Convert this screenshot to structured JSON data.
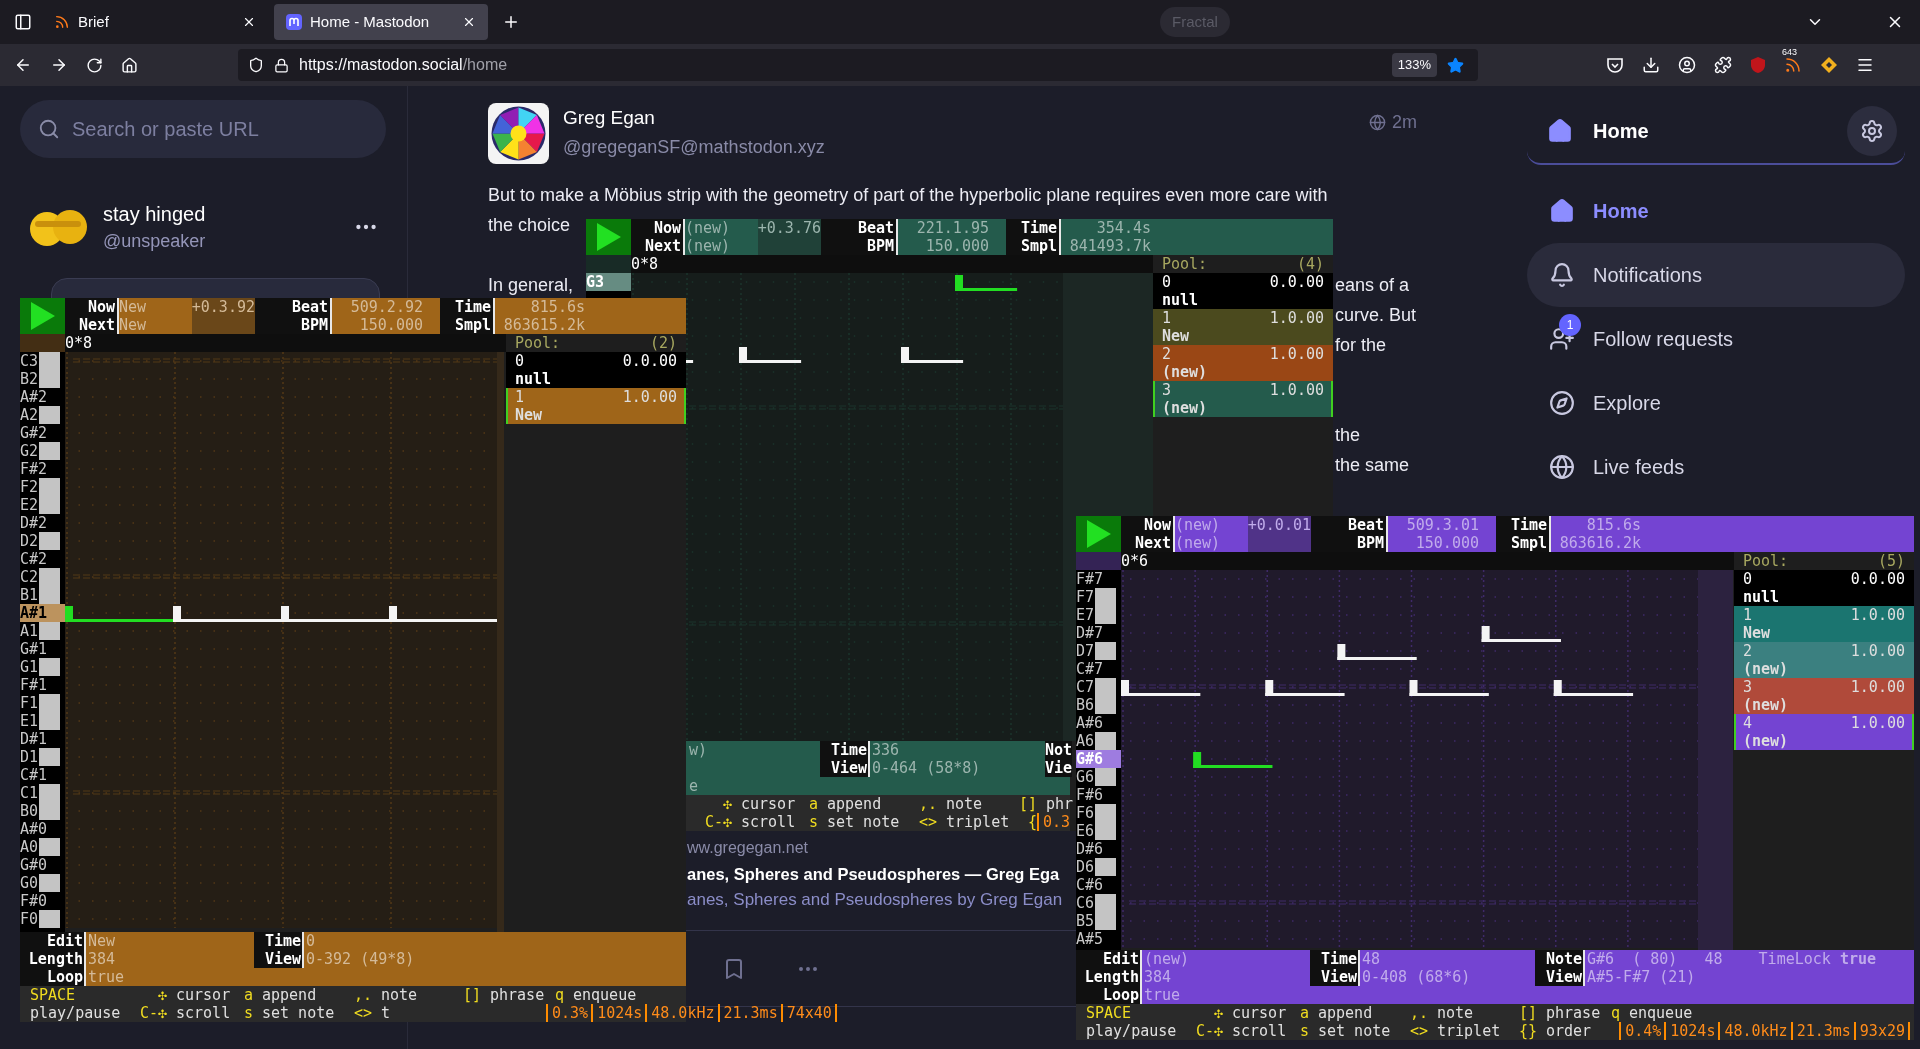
{
  "browser": {
    "tabs": [
      {
        "title": "Brief",
        "selected": false
      },
      {
        "title": "Home - Mastodon",
        "selected": true
      }
    ],
    "indicator": "Fractal",
    "url": {
      "domain": "https://mastodon.social",
      "path": "/home"
    },
    "zoom": "133%",
    "bookmarked": true,
    "extension_badge": "643"
  },
  "search": {
    "placeholder": "Search or paste URL"
  },
  "account": {
    "name": "stay hinged",
    "handle": "@unspeaker"
  },
  "post": {
    "author": "Greg Egan",
    "handle": "@gregeganSF@mathstodon.xyz",
    "time": "2m",
    "lines": [
      {
        "kind": "text",
        "left": "But to make a Möbius strip with the geometry of part of the hyperbolic plane requires even more care with"
      },
      {
        "kind": "text",
        "left": "the choice"
      },
      {
        "kind": "blank"
      },
      {
        "kind": "text",
        "left": "In general,",
        "right": "eans of a"
      },
      {
        "kind": "text",
        "right": "curve. But"
      },
      {
        "kind": "text",
        "right": "for the"
      },
      {
        "kind": "blank"
      },
      {
        "kind": "blank"
      },
      {
        "kind": "text",
        "right": "the"
      },
      {
        "kind": "text",
        "right": "the same"
      }
    ],
    "link": {
      "site": "ww.gregegan.net",
      "title": "anes, Spheres and Pseudospheres — Greg Ega",
      "description": "anes, Spheres and Pseudospheres by Greg Egan"
    }
  },
  "nav": {
    "header": "Home",
    "items": [
      {
        "label": "Home",
        "selected": true,
        "highlighted": false
      },
      {
        "label": "Notifications",
        "selected": false,
        "highlighted": true
      },
      {
        "label": "Follow requests",
        "selected": false,
        "highlighted": false,
        "badge": "1"
      },
      {
        "label": "Explore",
        "selected": false,
        "highlighted": false
      },
      {
        "label": "Live feeds",
        "selected": false,
        "highlighted": false
      }
    ]
  },
  "windows": [
    {
      "color": "#9f6519",
      "header": {
        "now_label": "Now",
        "next_label": "Next",
        "now": "New",
        "next": "New",
        "offset": "+0.3.92",
        "beat_label": "Beat",
        "bpm_label": "BPM",
        "beat": "509.2.92",
        "bpm": "150.000",
        "time_label": "Time",
        "smpl_label": "Smpl",
        "time": "815.6s",
        "smpl": "863615.2k"
      },
      "position": "0*8",
      "keys": [
        {
          "label": "C3",
          "kind": "white",
          "selected": false
        },
        {
          "label": "B2",
          "kind": "white",
          "selected": false
        },
        {
          "label": "A#2",
          "kind": "black",
          "selected": false
        },
        {
          "label": "A2",
          "kind": "white",
          "selected": false
        },
        {
          "label": "G#2",
          "kind": "black",
          "selected": false
        },
        {
          "label": "G2",
          "kind": "white",
          "selected": false
        },
        {
          "label": "F#2",
          "kind": "black",
          "selected": false
        },
        {
          "label": "F2",
          "kind": "white",
          "selected": false
        },
        {
          "label": "E2",
          "kind": "white",
          "selected": false
        },
        {
          "label": "D#2",
          "kind": "black",
          "selected": false
        },
        {
          "label": "D2",
          "kind": "white",
          "selected": false
        },
        {
          "label": "C#2",
          "kind": "black",
          "selected": false
        },
        {
          "label": "C2",
          "kind": "white",
          "selected": false
        },
        {
          "label": "B1",
          "kind": "white",
          "selected": false
        },
        {
          "label": "A#1",
          "kind": "black",
          "selected": true
        },
        {
          "label": "A1",
          "kind": "white",
          "selected": false
        },
        {
          "label": "G#1",
          "kind": "black",
          "selected": false
        },
        {
          "label": "G1",
          "kind": "white",
          "selected": false
        },
        {
          "label": "F#1",
          "kind": "black",
          "selected": false
        },
        {
          "label": "F1",
          "kind": "white",
          "selected": false
        },
        {
          "label": "E1",
          "kind": "white",
          "selected": false
        },
        {
          "label": "D#1",
          "kind": "black",
          "selected": false
        },
        {
          "label": "D1",
          "kind": "white",
          "selected": false
        },
        {
          "label": "C#1",
          "kind": "black",
          "selected": false
        },
        {
          "label": "C1",
          "kind": "white",
          "selected": false
        },
        {
          "label": "B0",
          "kind": "white",
          "selected": false
        },
        {
          "label": "A#0",
          "kind": "black",
          "selected": false
        },
        {
          "label": "A0",
          "kind": "white",
          "selected": false
        },
        {
          "label": "G#0",
          "kind": "black",
          "selected": false
        },
        {
          "label": "G0",
          "kind": "white",
          "selected": false
        },
        {
          "label": "F#0",
          "kind": "black",
          "selected": false
        },
        {
          "label": "F0",
          "kind": "white",
          "selected": false
        }
      ],
      "pool": {
        "title": "Pool:",
        "count": "(2)",
        "entries": [
          {
            "index": "0",
            "time": "0.0.00",
            "name": "null",
            "color": "#000000",
            "selected": false
          },
          {
            "index": "1",
            "time": "1.0.00",
            "name": "New",
            "color": "#9f6519",
            "selected": true
          }
        ]
      },
      "status": [
        {
          "lines": [
            {
              "label": "Edit",
              "value": "New"
            },
            {
              "label": "Length",
              "value": "384"
            },
            {
              "label": "Loop",
              "value": "true"
            }
          ]
        },
        {
          "lines": [
            {
              "label": "Time",
              "value": "0"
            },
            {
              "label": "View",
              "value": "0-392 (49*8)"
            }
          ]
        }
      ],
      "help": [
        [
          {
            "key": "SPACE"
          },
          {
            "label": "play/pause"
          }
        ],
        [
          {
            "key": "✣",
            "label": "cursor"
          },
          {
            "key": "C-✣",
            "label": "scroll"
          }
        ],
        [
          {
            "key": "a",
            "label": "append"
          },
          {
            "key": "s",
            "label": "set note"
          }
        ],
        [
          {
            "key": ",.",
            "label": "note"
          },
          {
            "key": "<>",
            "label": "t"
          }
        ],
        [
          {
            "key": "[]",
            "label": "phrase"
          }
        ],
        [
          {
            "key": "q",
            "label": "enqueue"
          }
        ]
      ],
      "stats": [
        "0.3%",
        "1024s",
        "48.0kHz",
        "21.3ms",
        "74x40"
      ]
    },
    {
      "color": "#245b4c",
      "header": {
        "now_label": "Now",
        "next_label": "Next",
        "now": "(new)",
        "next": "(new)",
        "offset": "+0.3.76",
        "beat_label": "Beat",
        "bpm_label": "BPM",
        "beat": "221.1.95",
        "bpm": "150.000",
        "time_label": "Time",
        "smpl_label": "Smpl",
        "time": "354.4s",
        "smpl": "841493.7k"
      },
      "position": "0*8",
      "keys": [
        {
          "label": "G3",
          "kind": "white",
          "selected": true
        }
      ],
      "pool": {
        "title": "Pool:",
        "count": "(4)",
        "entries": [
          {
            "index": "0",
            "time": "0.0.00",
            "name": "null",
            "color": "#000000",
            "selected": false
          },
          {
            "index": "1",
            "time": "1.0.00",
            "name": "New",
            "color": "#4b4a1e",
            "selected": false
          },
          {
            "index": "2",
            "time": "1.0.00",
            "name": "(new)",
            "color": "#9a4715",
            "selected": false
          },
          {
            "index": "3",
            "time": "1.0.00",
            "name": "(new)",
            "color": "#245b4c",
            "selected": true
          }
        ]
      },
      "status": [
        {
          "lines": [
            {
              "kind": "text",
              "value": "w)"
            },
            {
              "kind": "blank"
            },
            {
              "kind": "text",
              "value": "e"
            }
          ]
        },
        {
          "lines": [
            {
              "label": "Time",
              "value": "336"
            },
            {
              "label": "View",
              "value": "0-464 (58*8)"
            }
          ]
        },
        {
          "lines": [
            {
              "label": "Not"
            },
            {
              "label": "Vie"
            }
          ]
        }
      ],
      "help": [
        [
          {
            "key": "✣",
            "label": "cursor"
          },
          {
            "key": "C-✣",
            "label": "scroll"
          }
        ],
        [
          {
            "key": "a",
            "label": "append"
          },
          {
            "key": "s",
            "label": "set note"
          }
        ],
        [
          {
            "key": ",.",
            "label": "note"
          },
          {
            "key": "<>",
            "label": "triplet"
          }
        ],
        [
          {
            "key": "[]",
            "label": "phr"
          },
          {
            "key": "{"
          }
        ]
      ],
      "stats": [
        "0.3"
      ]
    },
    {
      "color": "#7444d2",
      "header": {
        "now_label": "Now",
        "next_label": "Next",
        "now": "(new)",
        "next": "(new)",
        "offset": "+0.0.01",
        "beat_label": "Beat",
        "bpm_label": "BPM",
        "beat": "509.3.01",
        "bpm": "150.000",
        "time_label": "Time",
        "smpl_label": "Smpl",
        "time": "815.6s",
        "smpl": "863616.2k"
      },
      "position": "0*6",
      "keys": [
        {
          "label": "F#7",
          "kind": "black",
          "selected": false
        },
        {
          "label": "F7",
          "kind": "white",
          "selected": false
        },
        {
          "label": "E7",
          "kind": "white",
          "selected": false
        },
        {
          "label": "D#7",
          "kind": "black",
          "selected": false
        },
        {
          "label": "D7",
          "kind": "white",
          "selected": false
        },
        {
          "label": "C#7",
          "kind": "black",
          "selected": false
        },
        {
          "label": "C7",
          "kind": "white",
          "selected": false
        },
        {
          "label": "B6",
          "kind": "white",
          "selected": false
        },
        {
          "label": "A#6",
          "kind": "black",
          "selected": false
        },
        {
          "label": "A6",
          "kind": "white",
          "selected": false
        },
        {
          "label": "G#6",
          "kind": "black",
          "selected": true
        },
        {
          "label": "G6",
          "kind": "white",
          "selected": false
        },
        {
          "label": "F#6",
          "kind": "black",
          "selected": false
        },
        {
          "label": "F6",
          "kind": "white",
          "selected": false
        },
        {
          "label": "E6",
          "kind": "white",
          "selected": false
        },
        {
          "label": "D#6",
          "kind": "black",
          "selected": false
        },
        {
          "label": "D6",
          "kind": "white",
          "selected": false
        },
        {
          "label": "C#6",
          "kind": "black",
          "selected": false
        },
        {
          "label": "C6",
          "kind": "white",
          "selected": false
        },
        {
          "label": "B5",
          "kind": "white",
          "selected": false
        },
        {
          "label": "A#5",
          "kind": "black",
          "selected": false
        }
      ],
      "pool": {
        "title": "Pool:",
        "count": "(5)",
        "entries": [
          {
            "index": "0",
            "time": "0.0.00",
            "name": "null",
            "color": "#000000",
            "selected": false
          },
          {
            "index": "1",
            "time": "1.0.00",
            "name": "New",
            "color": "#1b7570",
            "selected": false
          },
          {
            "index": "2",
            "time": "1.0.00",
            "name": "(new)",
            "color": "#3b8080",
            "selected": false
          },
          {
            "index": "3",
            "time": "1.0.00",
            "name": "(new)",
            "color": "#b04a3a",
            "selected": false
          },
          {
            "index": "4",
            "time": "1.0.00",
            "name": "(new)",
            "color": "#7444d2",
            "selected": true
          }
        ]
      },
      "status": [
        {
          "lines": [
            {
              "label": "Edit",
              "value": "(new)"
            },
            {
              "label": "Length",
              "value": "384"
            },
            {
              "label": "Loop",
              "value": "true"
            }
          ]
        },
        {
          "lines": [
            {
              "label": "Time",
              "value": "48"
            },
            {
              "label": "View",
              "value": "0-408 (68*6)"
            }
          ]
        },
        {
          "lines": [
            {
              "label": "Note",
              "value": "G#6  ( 80)   48    TimeLock **true**"
            },
            {
              "label": "View",
              "value": "A#5-F#7 (21)"
            }
          ]
        }
      ],
      "help": [
        [
          {
            "key": "SPACE"
          },
          {
            "label": "play/pause"
          }
        ],
        [
          {
            "key": "✣",
            "label": "cursor"
          },
          {
            "key": "C-✣",
            "label": "scroll"
          }
        ],
        [
          {
            "key": "a",
            "label": "append"
          },
          {
            "key": "s",
            "label": "set note"
          }
        ],
        [
          {
            "key": ",.",
            "label": "note"
          },
          {
            "key": "<>",
            "label": "triplet"
          }
        ],
        [
          {
            "key": "[]",
            "label": "phrase"
          },
          {
            "key": "{}",
            "label": "order"
          }
        ],
        [
          {
            "key": "q",
            "label": "enqueue"
          }
        ]
      ],
      "stats": [
        "0.4%",
        "1024s",
        "48.0kHz",
        "21.3ms",
        "93x29"
      ]
    }
  ]
}
